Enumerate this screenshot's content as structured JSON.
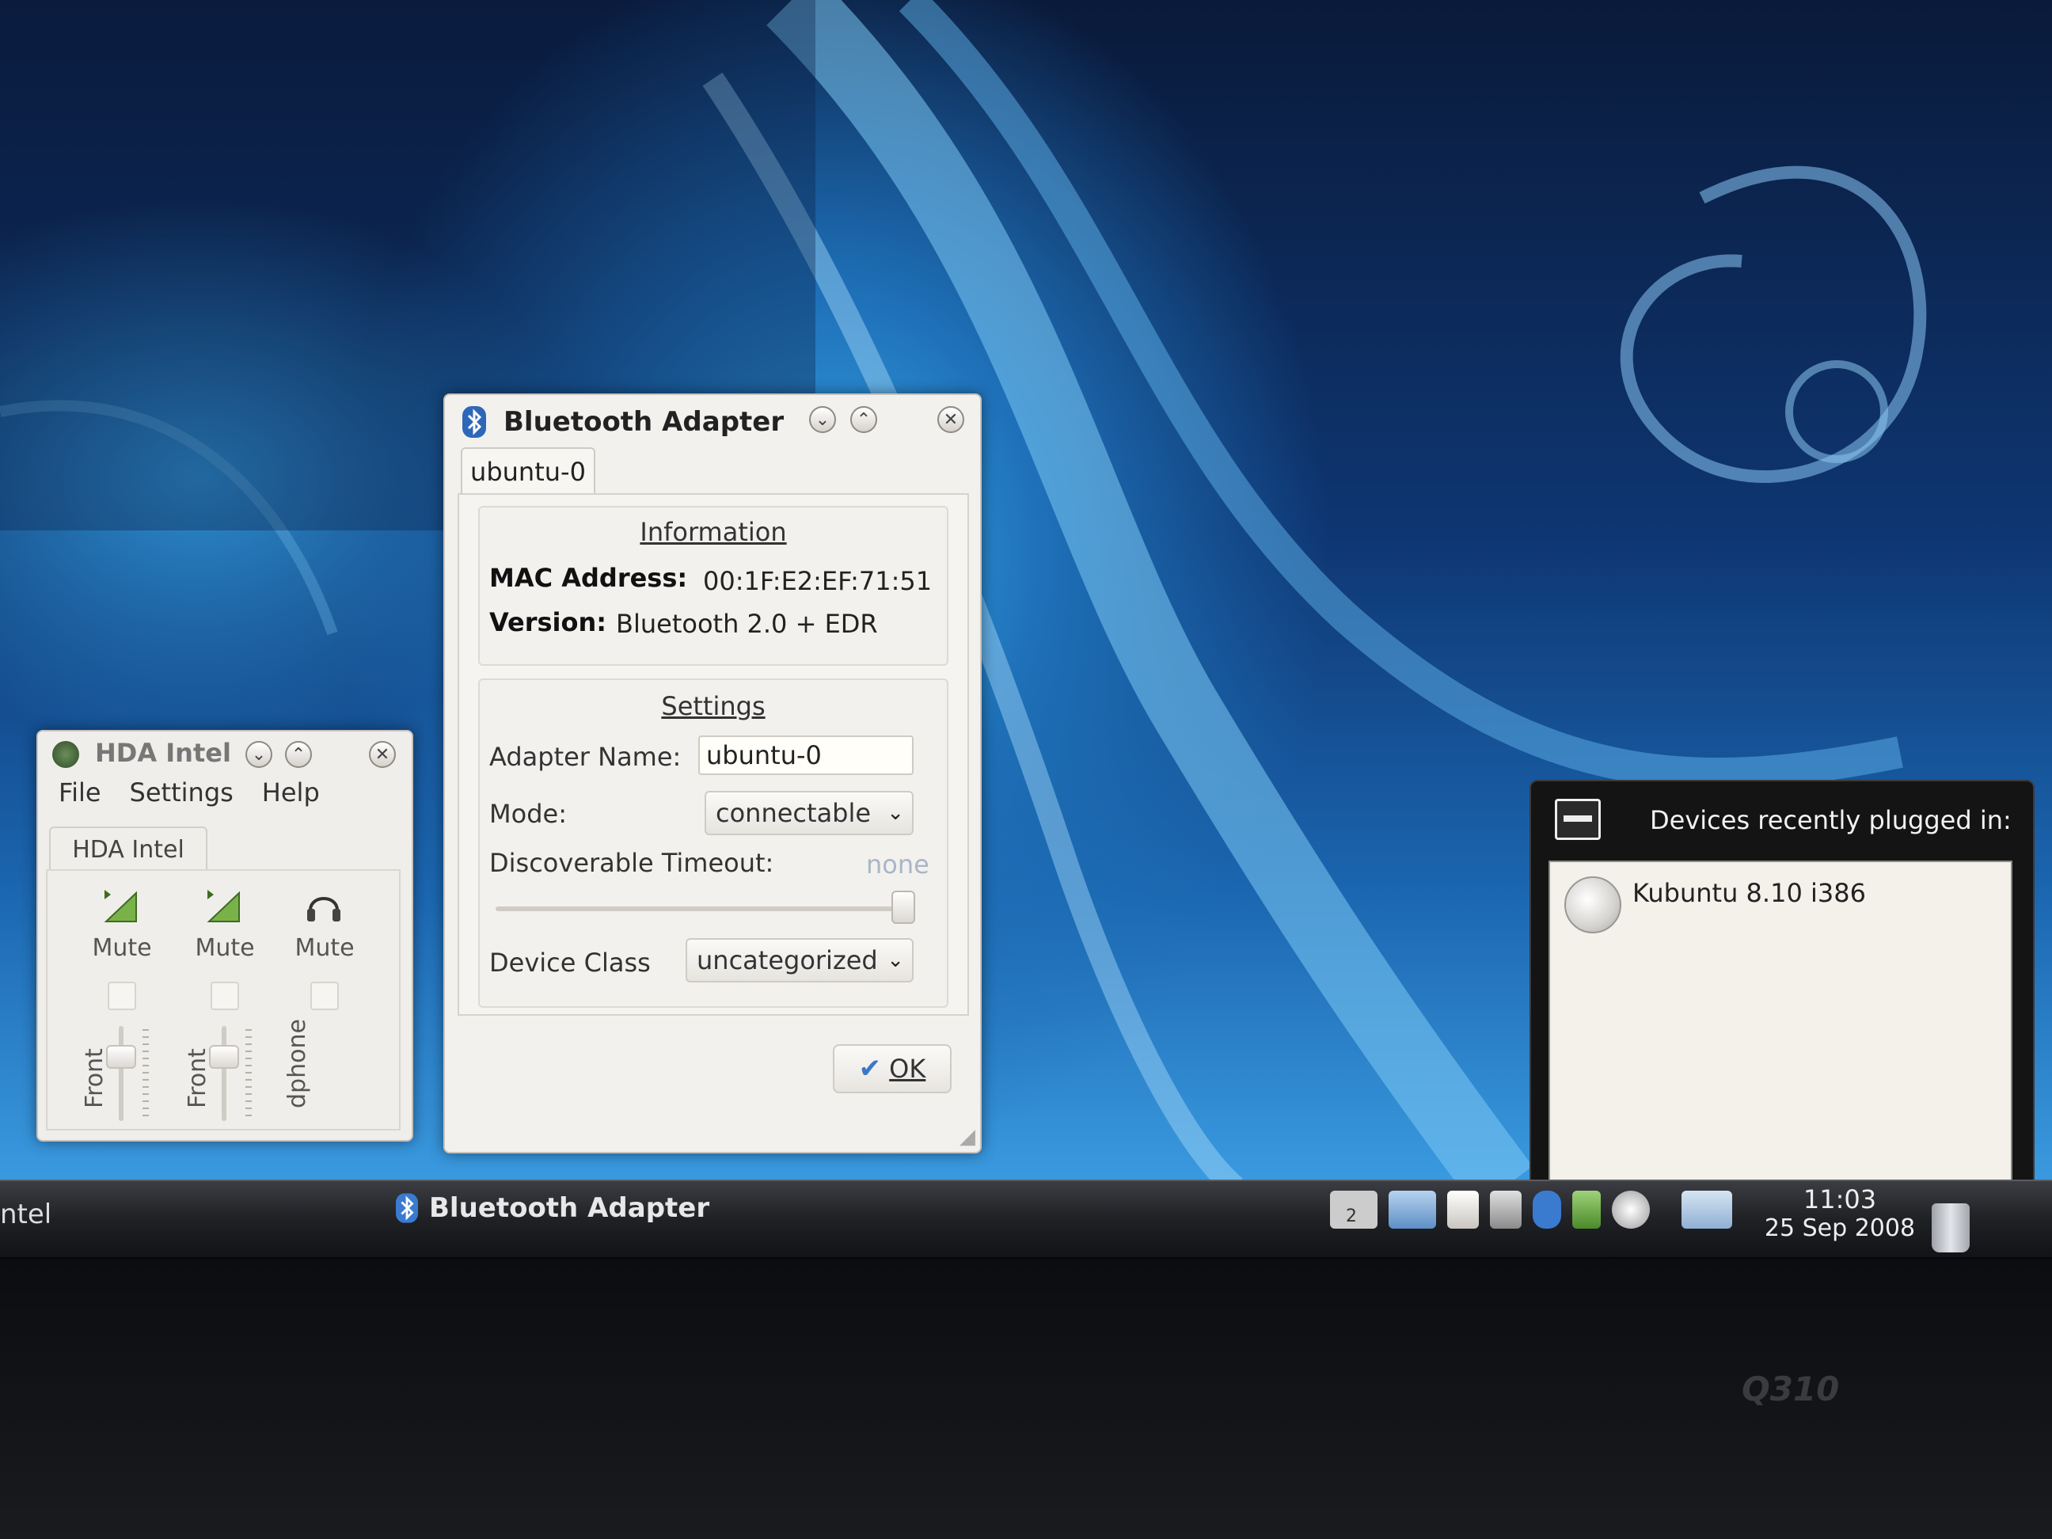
{
  "bluetooth_dialog": {
    "title": "Bluetooth Adapter",
    "tab": "ubuntu-0",
    "information": {
      "heading": "Information",
      "mac_label": "MAC Address:",
      "mac_value": "00:1F:E2:EF:71:51",
      "version_label": "Version:",
      "version_value": "Bluetooth 2.0 + EDR"
    },
    "settings": {
      "heading": "Settings",
      "adapter_name_label": "Adapter Name:",
      "adapter_name_value": "ubuntu-0",
      "mode_label": "Mode:",
      "mode_value": "connectable",
      "timeout_label": "Discoverable Timeout:",
      "timeout_value": "none",
      "device_class_label": "Device Class",
      "device_class_value": "uncategorized"
    },
    "ok_label": "OK"
  },
  "mixer": {
    "title": "HDA Intel",
    "menu": [
      "File",
      "Settings",
      "Help"
    ],
    "tab": "HDA Intel",
    "channels": [
      {
        "mute_label": "Mute",
        "name": "Front",
        "icon": "speaker-volume-icon"
      },
      {
        "mute_label": "Mute",
        "name": "Front",
        "icon": "speaker-volume-icon"
      },
      {
        "mute_label": "Mute",
        "name": "dphone",
        "icon": "headphones-icon"
      }
    ]
  },
  "devices_notifier": {
    "title": "Devices recently plugged in:",
    "items": [
      "Kubuntu 8.10 i386"
    ]
  },
  "taskbar": {
    "left_task": "ntel",
    "bt_task": "Bluetooth Adapter",
    "pager_label": "2",
    "clock_time": "11:03",
    "clock_date": "25 Sep 2008"
  },
  "bezel": {
    "model": "Q310"
  },
  "colors": {
    "accent": "#3b78c4",
    "desktop": "#1e70b8",
    "panel": "#1f2125"
  }
}
